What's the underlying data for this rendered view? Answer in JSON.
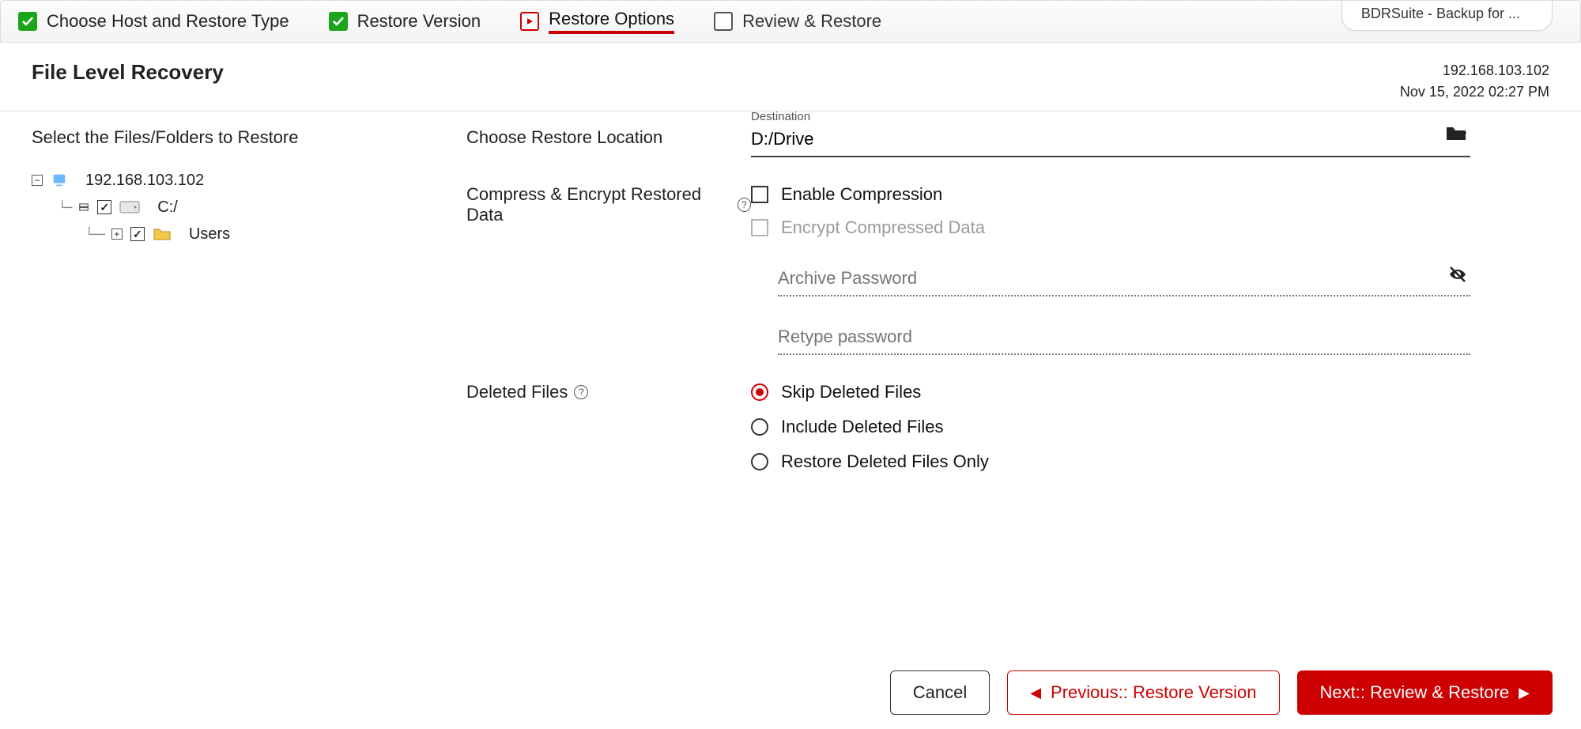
{
  "app_tab": "BDRSuite - Backup for ...",
  "stepper": {
    "step1": "Choose Host and Restore Type",
    "step2": "Restore Version",
    "step3": "Restore Options",
    "step4": "Review & Restore"
  },
  "header": {
    "title": "File Level Recovery",
    "host": "192.168.103.102",
    "timestamp": "Nov 15, 2022 02:27 PM"
  },
  "left": {
    "subtitle": "Select the Files/Folders to Restore",
    "tree": {
      "root_label": "192.168.103.102",
      "drive_label": "C:/",
      "folder_label": "Users"
    }
  },
  "right": {
    "location_label": "Choose Restore Location",
    "destination_caption": "Destination",
    "destination_value": "D:/Drive",
    "compress_label": "Compress & Encrypt Restored Data",
    "enable_compression": "Enable Compression",
    "encrypt_compressed": "Encrypt Compressed Data",
    "archive_password": "Archive Password",
    "retype_password": "Retype password",
    "deleted_label": "Deleted Files",
    "radio_skip": "Skip Deleted Files",
    "radio_include": "Include Deleted Files",
    "radio_only": "Restore Deleted Files Only"
  },
  "footer": {
    "cancel": "Cancel",
    "prev": "Previous:: Restore Version",
    "next": "Next:: Review & Restore"
  }
}
